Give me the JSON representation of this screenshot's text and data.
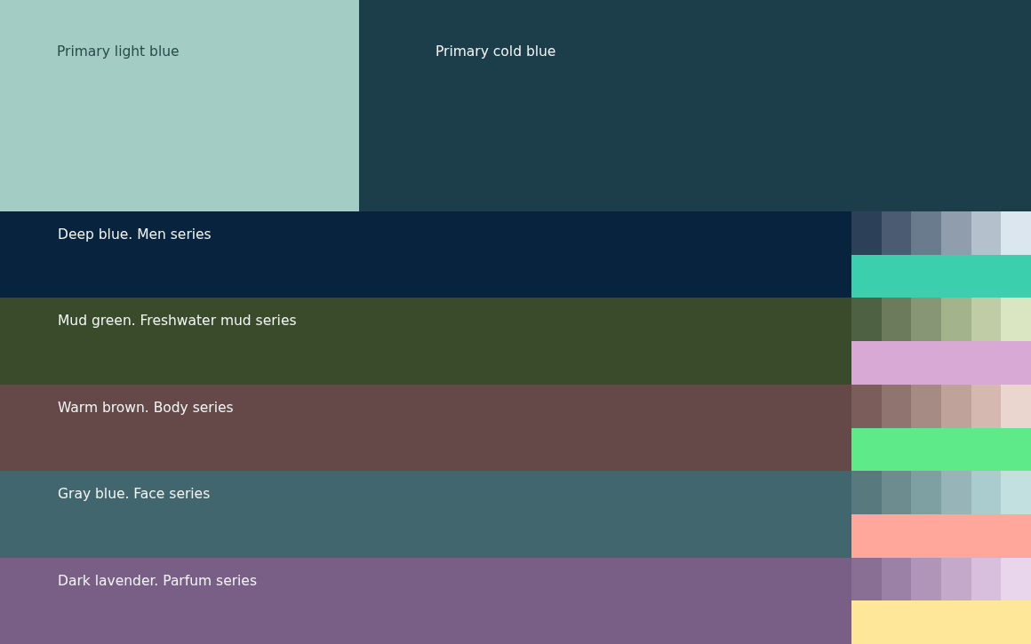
{
  "primaries": [
    {
      "name": "Primary light blue",
      "color": "#a3cdc4"
    },
    {
      "name": "Primary cold blue",
      "color": "#1c3d4a"
    }
  ],
  "series": [
    {
      "name": "Deep blue. Men series",
      "color": "#07233d",
      "tints": [
        {
          "color": "#2c4158"
        },
        {
          "color": "#4a5b72"
        },
        {
          "color": "#6b7b8e"
        },
        {
          "color": "#8f9dac"
        },
        {
          "color": "#b4c0cc"
        },
        {
          "color": "#dce6ef"
        }
      ],
      "accent": {
        "color": "#3ccfae"
      }
    },
    {
      "name": "Mud green. Freshwater mud series",
      "color": "#394b2b",
      "tints": [
        {
          "color": "#4e6143"
        },
        {
          "color": "#6b7b5c"
        },
        {
          "color": "#879775"
        },
        {
          "color": "#a3b38c"
        },
        {
          "color": "#bfcca5"
        },
        {
          "color": "#dae6c2"
        }
      ],
      "accent": {
        "color": "#d9a9d6"
      }
    },
    {
      "name": "Warm brown. Body series",
      "color": "#654949",
      "tints": [
        {
          "color": "#7b5d5b"
        },
        {
          "color": "#8f7470"
        },
        {
          "color": "#a58b84"
        },
        {
          "color": "#bfa39b"
        },
        {
          "color": "#d5b9b1"
        },
        {
          "color": "#ebd6cf"
        }
      ],
      "accent": {
        "color": "#5eea88"
      }
    },
    {
      "name": "Gray blue. Face series",
      "color": "#42666d",
      "tints": [
        {
          "color": "#587a7e"
        },
        {
          "color": "#6c8c90"
        },
        {
          "color": "#7fa0a3"
        },
        {
          "color": "#97b5b8"
        },
        {
          "color": "#aaccce"
        },
        {
          "color": "#c1e0df"
        }
      ],
      "accent": {
        "color": "#ffa79b"
      }
    },
    {
      "name": "Dark lavender. Parfum series",
      "color": "#795e86",
      "tints": [
        {
          "color": "#8a6f95"
        },
        {
          "color": "#9c81a6"
        },
        {
          "color": "#b095b8"
        },
        {
          "color": "#c4a9cb"
        },
        {
          "color": "#d8bfdd"
        },
        {
          "color": "#e9d6ec"
        }
      ],
      "accent": {
        "color": "#fee799"
      }
    }
  ]
}
